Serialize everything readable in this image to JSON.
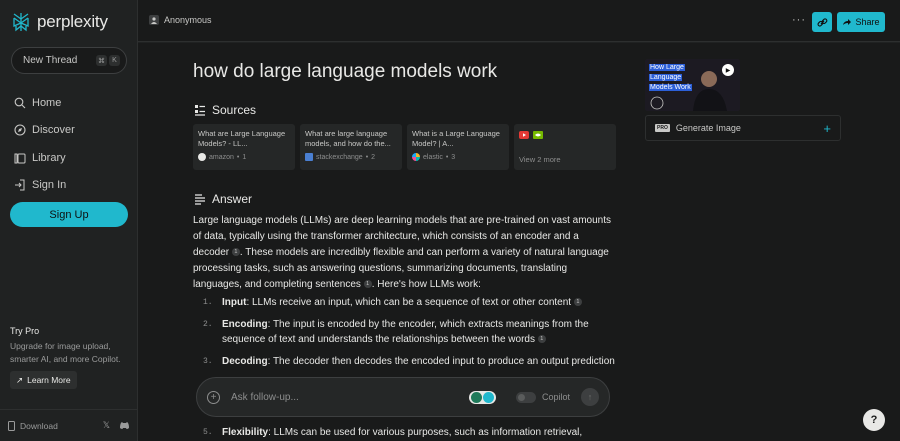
{
  "app": {
    "name": "perplexity"
  },
  "sidebar": {
    "new_thread": {
      "label": "New Thread",
      "shortcut": [
        "⌘",
        "K"
      ]
    },
    "items": [
      {
        "label": "Home",
        "icon": "search-icon"
      },
      {
        "label": "Discover",
        "icon": "compass-icon"
      },
      {
        "label": "Library",
        "icon": "library-icon"
      },
      {
        "label": "Sign In",
        "icon": "sign-in-icon"
      }
    ],
    "signup_label": "Sign Up",
    "try_pro": {
      "title": "Try Pro",
      "description": "Upgrade for image upload, smarter AI, and more Copilot.",
      "learn_more": "Learn More"
    },
    "footer": {
      "download_label": "Download"
    }
  },
  "topbar": {
    "user": "Anonymous",
    "share_label": "Share"
  },
  "thread": {
    "question": "how do large language models work",
    "sources_heading": "Sources",
    "sources": [
      {
        "title": "What are Large Language Models? - LL...",
        "site": "amazon",
        "index": "1",
        "color": "#e8e8e6"
      },
      {
        "title": "What are large language models, and how do the...",
        "site": "stackexchange",
        "index": "2",
        "color": "#4a7fd1"
      },
      {
        "title": "What is a Large Language Model? | A...",
        "site": "elastic",
        "index": "3",
        "color": "#f0b429"
      }
    ],
    "view_more": "View 2 more",
    "answer_heading": "Answer",
    "answer_paragraph": {
      "part1": "Large language models (LLMs) are deep learning models that are pre-trained on vast amounts of data, typically using the transformer architecture, which consists of an encoder and a decoder",
      "cite1": "1",
      "part2": ". These models are incredibly flexible and can perform a variety of natural language processing tasks, such as answering questions, summarizing documents, translating languages, and completing sentences",
      "cite2": "1",
      "part3": ". Here's how LLMs work:"
    },
    "steps": [
      {
        "num": "1.",
        "term": "Input",
        "text": ": LLMs receive an input, which can be a sequence of text or other content",
        "cite": "1"
      },
      {
        "num": "2.",
        "term": "Encoding",
        "text": ": The input is encoded by the encoder, which extracts meanings from the sequence of text and understands the relationships between the words",
        "cite": "1"
      },
      {
        "num": "3.",
        "term": "Decoding",
        "text": ": The decoder then decodes the encoded input to produce an output prediction",
        "cite": "1"
      }
    ],
    "step5": {
      "num": "5.",
      "term": "Flexibility",
      "text": ": LLMs can be used for various purposes, such as information retrieval,"
    }
  },
  "followup": {
    "placeholder": "Ask follow-up...",
    "copilot_label": "Copilot"
  },
  "right_panel": {
    "video_title": [
      "How Large",
      "Language",
      "Models Work"
    ],
    "pro_tag": "PRO",
    "generate_image": "Generate Image"
  },
  "help_label": "?",
  "colors": {
    "accent": "#20b8cd",
    "background": "#191a1a",
    "sidebar": "#202222"
  }
}
